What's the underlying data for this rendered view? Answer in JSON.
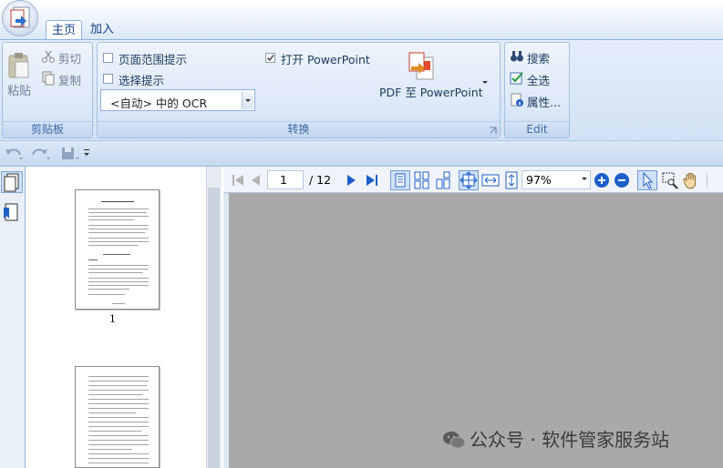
{
  "ribbon": {
    "tabs": [
      {
        "label": "主页",
        "active": true
      },
      {
        "label": "加入",
        "active": false
      }
    ],
    "clipboard": {
      "paste_label": "粘贴",
      "cut_label": "剪切",
      "copy_label": "复制",
      "group_label": "剪贴板"
    },
    "convert": {
      "page_range_label": "页面范围提示",
      "page_range_checked": false,
      "select_prompt_label": "选择提示",
      "select_prompt_checked": false,
      "open_ppt_label": "打开 PowerPoint",
      "open_ppt_checked": true,
      "ocr_value": "<自动> 中的 OCR",
      "pdf_to_ppt_label": "PDF 至 PowerPoint",
      "group_label": "转换"
    },
    "edit": {
      "search_label": "搜索",
      "select_all_label": "全选",
      "properties_label": "属性...",
      "group_label": "Edit"
    }
  },
  "thumbnails": {
    "page1_label": "1"
  },
  "doc_toolbar": {
    "current_page": "1",
    "total_pages": "/ 12",
    "zoom": "97%"
  },
  "watermark": {
    "text": "公众号 · 软件管家服务站"
  },
  "colors": {
    "accent": "#15428b",
    "viewer_bg": "#a9a9a9",
    "ribbon_bg": "#d2e1f4"
  }
}
